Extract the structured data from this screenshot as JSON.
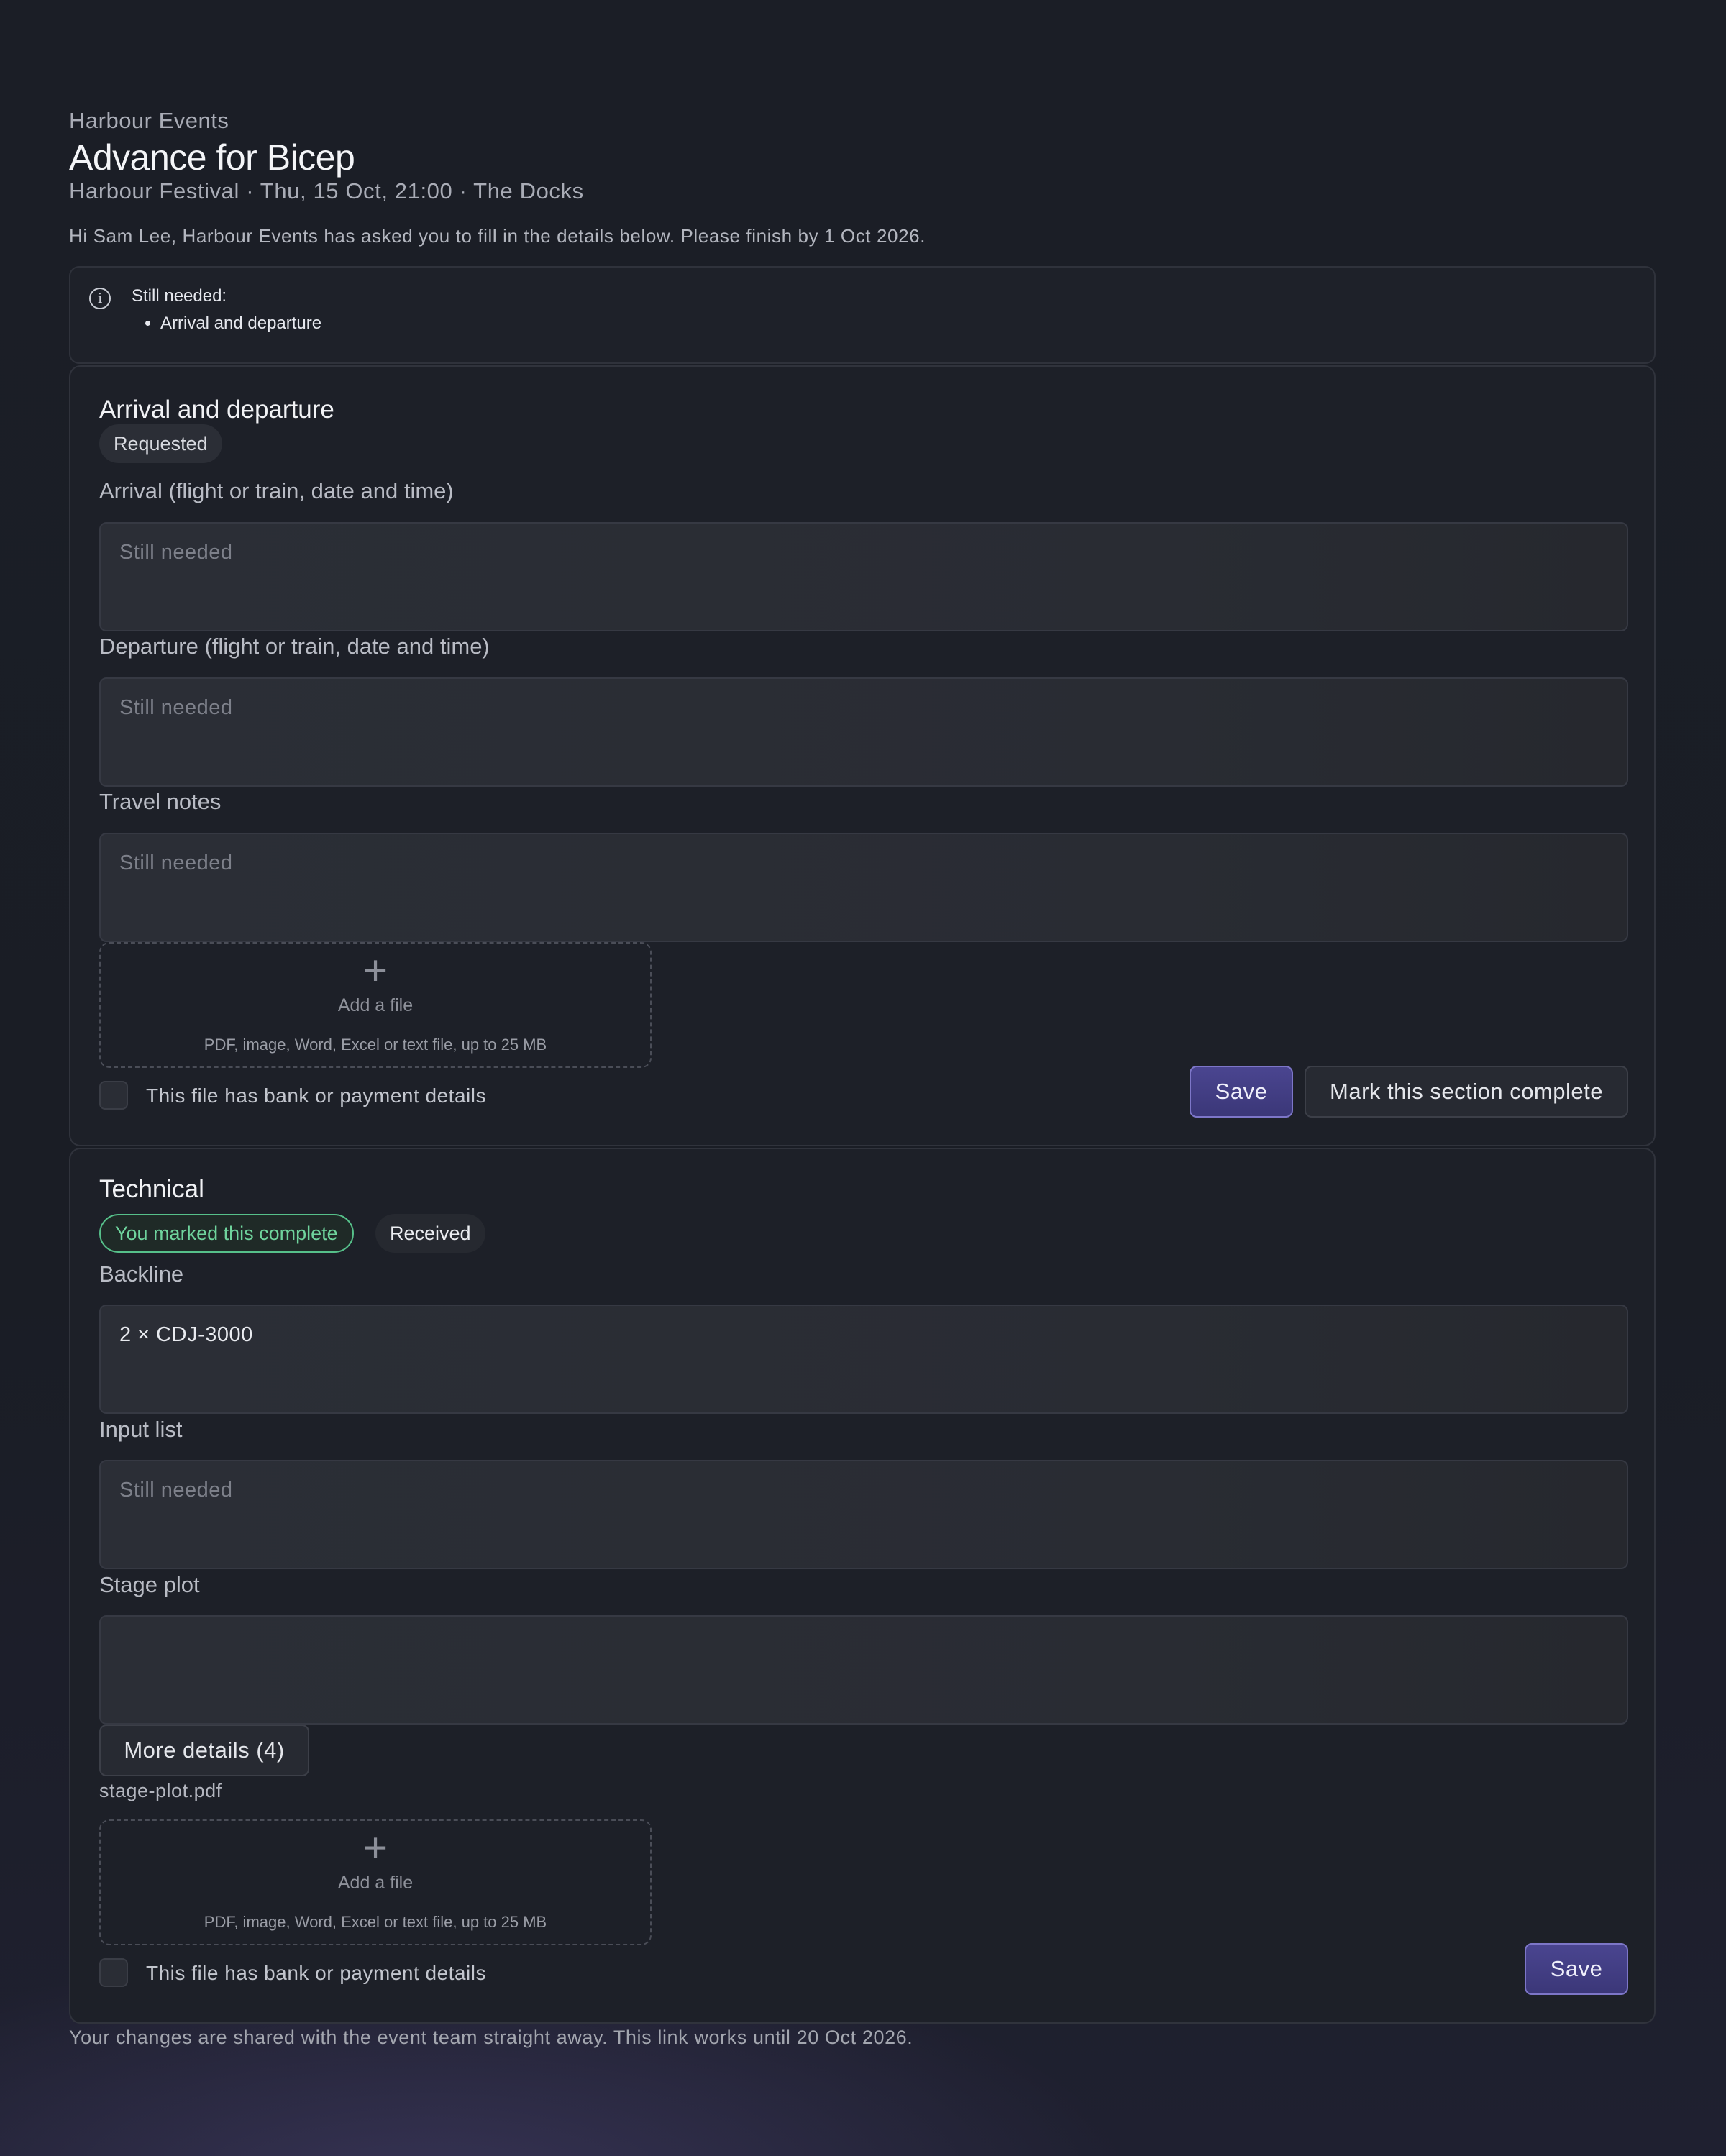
{
  "header": {
    "organizer": "Harbour Events",
    "title": "Advance for Bicep",
    "subtitle": "Harbour Festival · Thu, 15 Oct, 21:00 · The Docks",
    "intro": "Hi Sam Lee, Harbour Events has asked you to fill in the details below. Please finish by 1 Oct 2026."
  },
  "notice": {
    "icon": "info-icon",
    "heading": "Still needed:",
    "items": [
      "Arrival and departure"
    ]
  },
  "sections": {
    "arrival": {
      "title": "Arrival and departure",
      "status_badge": "Requested",
      "fields": [
        {
          "label": "Arrival (flight or train, date and time)",
          "value": "",
          "placeholder": "Still needed"
        },
        {
          "label": "Departure (flight or train, date and time)",
          "value": "",
          "placeholder": "Still needed"
        },
        {
          "label": "Travel notes",
          "value": "",
          "placeholder": "Still needed"
        }
      ],
      "upload": {
        "label": "Add a file",
        "hint": "PDF, image, Word, Excel or text file, up to 25 MB"
      },
      "bank_checkbox_label": "This file has bank or payment details",
      "save_label": "Save",
      "complete_label": "Mark this section complete"
    },
    "technical": {
      "title": "Technical",
      "complete_badge": "You marked this complete",
      "status_badge": "Received",
      "fields": [
        {
          "label": "Backline",
          "value": "2 × CDJ-3000",
          "placeholder": ""
        },
        {
          "label": "Input list",
          "value": "",
          "placeholder": "Still needed"
        },
        {
          "label": "Stage plot",
          "value": "",
          "placeholder": ""
        }
      ],
      "more_details_label": "More details (4)",
      "attached_file": "stage-plot.pdf",
      "upload": {
        "label": "Add a file",
        "hint": "PDF, image, Word, Excel or text file, up to 25 MB"
      },
      "bank_checkbox_label": "This file has bank or payment details",
      "save_label": "Save"
    }
  },
  "footer": {
    "text": "Your changes are shared with the event team straight away. This link works until 20 Oct 2026."
  },
  "colors": {
    "accent": "#4a4590",
    "complete": "#56c08a",
    "background": "#1b1e26"
  }
}
